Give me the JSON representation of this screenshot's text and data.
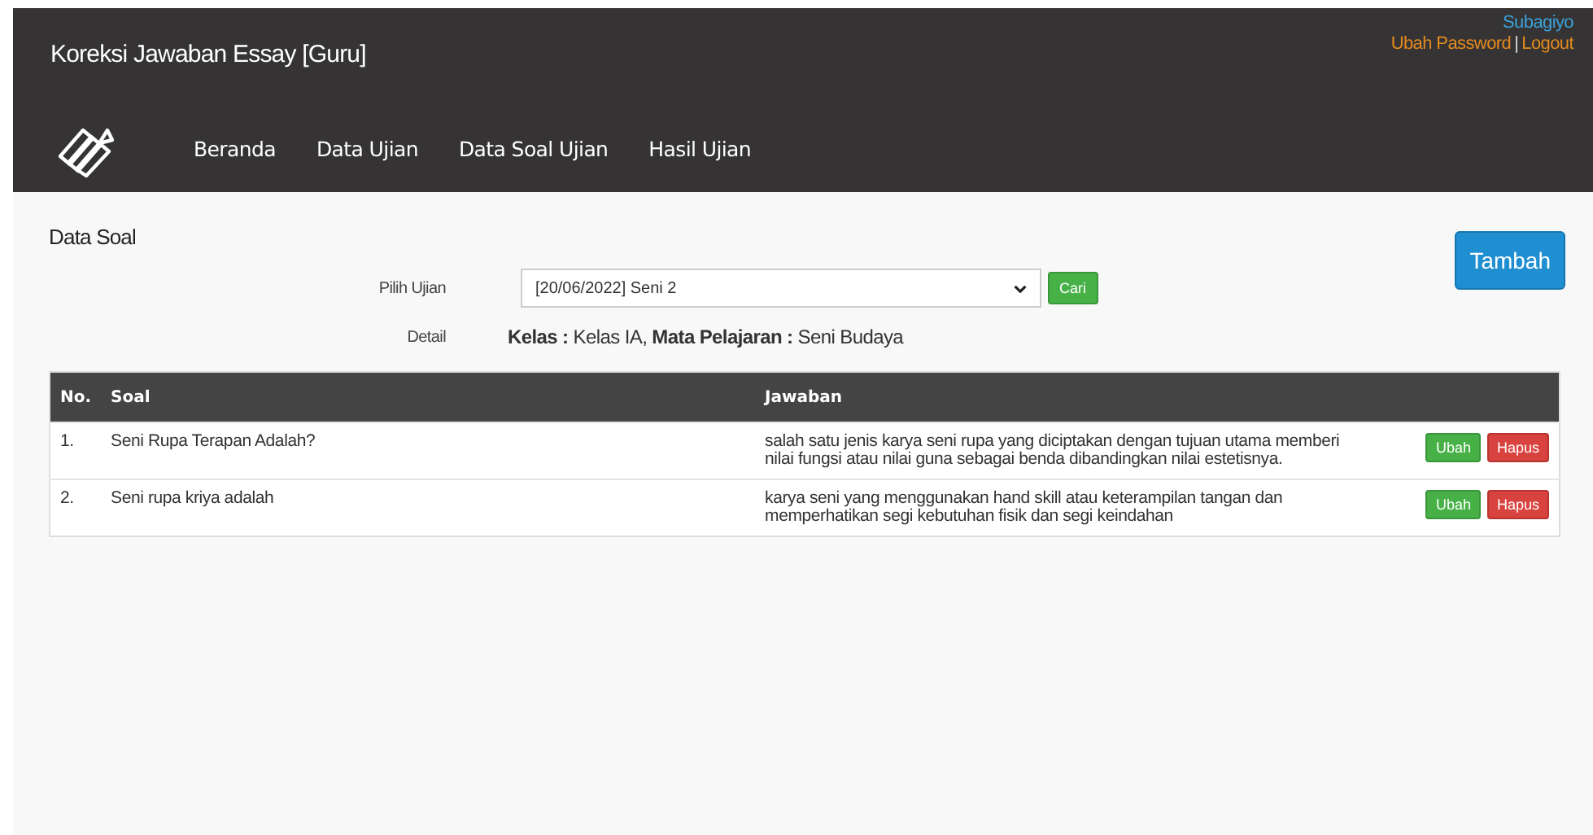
{
  "header": {
    "title": "Koreksi Jawaban Essay [Guru]",
    "user": "Subagiyo",
    "links": [
      "Ubah Password",
      "Logout"
    ],
    "separator": "|"
  },
  "nav": [
    {
      "label": "Beranda"
    },
    {
      "label": "Data Ujian"
    },
    {
      "label": "Data Soal Ujian"
    },
    {
      "label": "Hasil Ujian"
    }
  ],
  "page": {
    "title": "Data Soal",
    "add_button": "Tambah"
  },
  "filter": {
    "label": "Pilih Ujian",
    "value": "[20/06/2022] Seni 2",
    "button": "Cari"
  },
  "detail": {
    "label": "Detail",
    "text": "**Kelas :** Kelas IA, **Mata Pelajaran :** Seni Budaya"
  },
  "table": {
    "columns": [
      "No.",
      "Soal",
      "Jawaban"
    ],
    "rows": [
      {
        "no": "1.",
        "soal": "Seni Rupa Terapan Adalah?",
        "jawaban": "salah satu jenis karya seni rupa yang diciptakan dengan tujuan utama memberi nilai fungsi atau nilai guna sebagai benda dibandingkan nilai estetisnya.",
        "actions": [
          "Ubah",
          "Hapus"
        ]
      },
      {
        "no": "2.",
        "soal": "Seni rupa kriya adalah",
        "jawaban": "karya seni yang menggunakan hand skill atau keterampilan tangan dan memperhatikan segi kebutuhan fisik dan segi keindahan",
        "actions": [
          "Ubah",
          "Hapus"
        ]
      }
    ]
  }
}
